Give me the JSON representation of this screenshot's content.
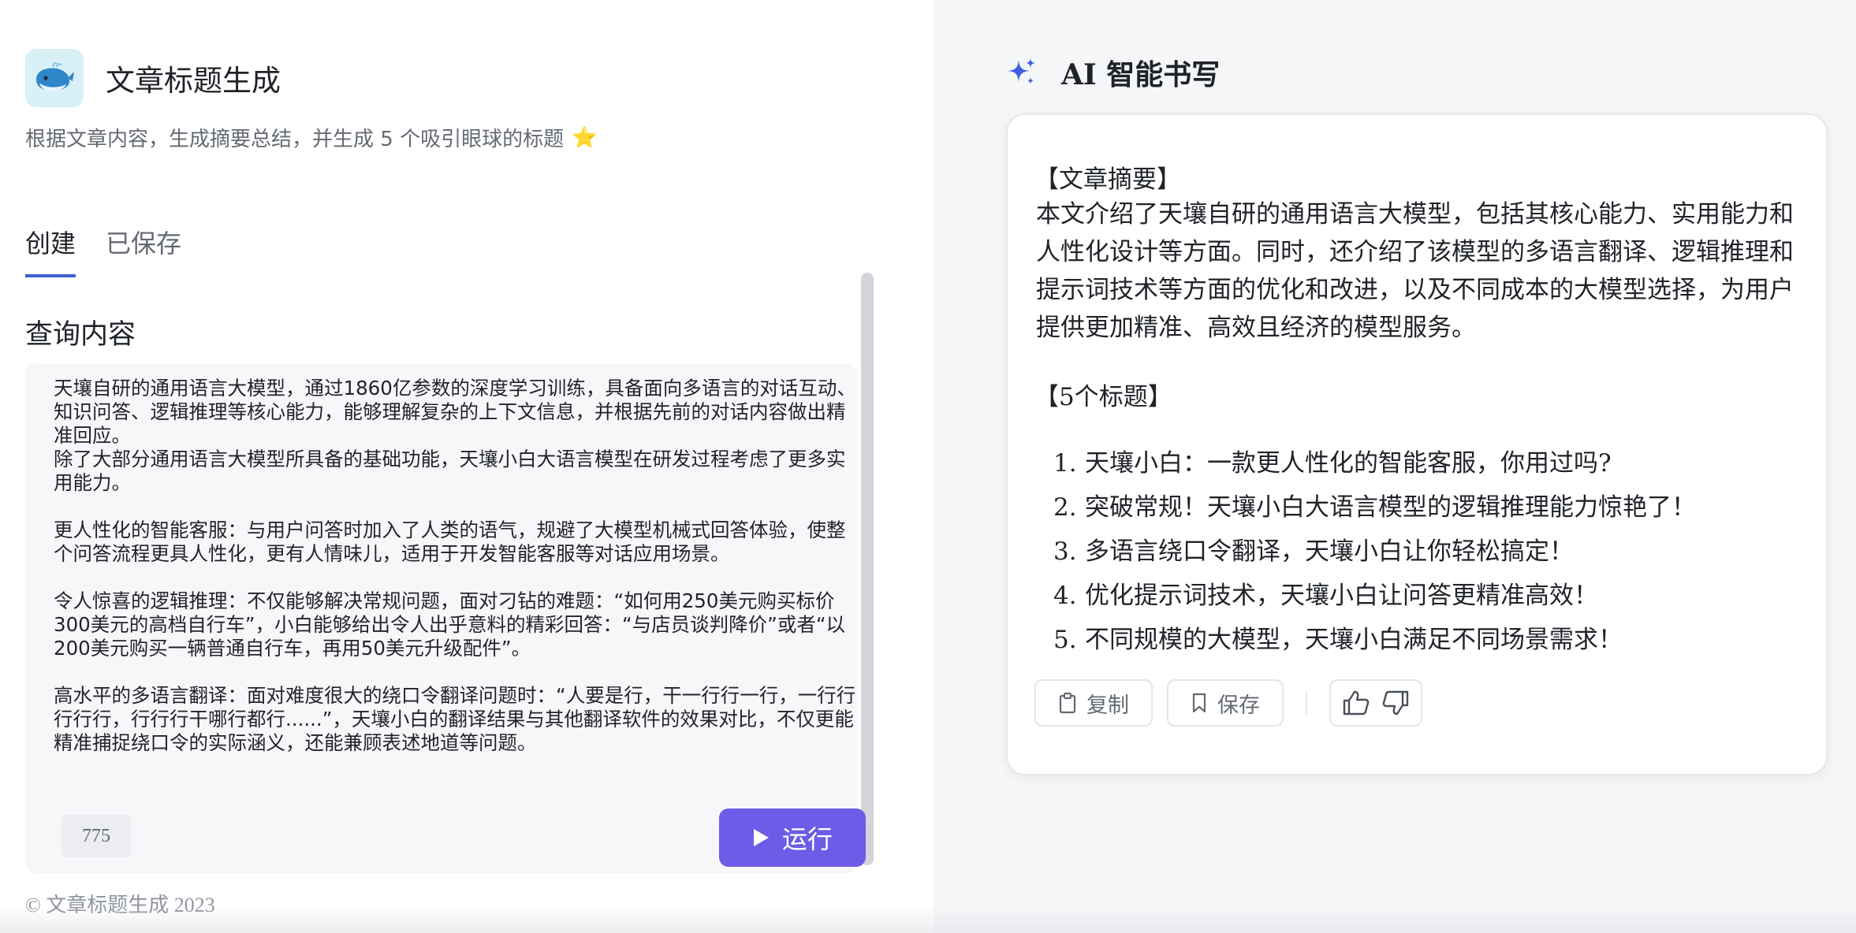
{
  "app": {
    "title": "文章标题生成",
    "description": "根据文章内容，生成摘要总结，并生成 5 个吸引眼球的标题",
    "star": "⭐"
  },
  "tabs": [
    {
      "label": "创建",
      "active": true
    },
    {
      "label": "已保存",
      "active": false
    }
  ],
  "query": {
    "label": "查询内容",
    "text": "天壤自研的通用语言大模型，通过1860亿参数的深度学习训练，具备面向多语言的对话互动、知识问答、逻辑推理等核心能力，能够理解复杂的上下文信息，并根据先前的对话内容做出精准回应。\n除了大部分通用语言大模型所具备的基础功能，天壤小白大语言模型在研发过程考虑了更多实用能力。\n\n更人性化的智能客服：与用户问答时加入了人类的语气，规避了大模型机械式回答体验，使整个问答流程更具人性化，更有人情味儿，适用于开发智能客服等对话应用场景。\n\n令人惊喜的逻辑推理：不仅能够解决常规问题，面对刁钻的难题：“如何用250美元购买标价300美元的高档自行车”，小白能够给出令人出乎意料的精彩回答：“与店员谈判降价”或者“以200美元购买一辆普通自行车，再用50美元升级配件”。\n\n高水平的多语言翻译：面对难度很大的绕口令翻译问题时：“人要是行，干一行行一行，一行行行行行，行行行干哪行都行......”，天壤小白的翻译结果与其他翻译软件的效果对比，不仅更能精准捕捉绕口令的实际涵义，还能兼顾表述地道等问题。",
    "char_count": "775",
    "run_label": "运行"
  },
  "footer": "© 文章标题生成 2023",
  "ai": {
    "title": "AI 智能书写",
    "summary_heading": "【文章摘要】",
    "summary": "本文介绍了天壤自研的通用语言大模型，包括其核心能力、实用能力和人性化设计等方面。同时，还介绍了该模型的多语言翻译、逻辑推理和提示词技术等方面的优化和改进，以及不同成本的大模型选择，为用户提供更加精准、高效且经济的模型服务。",
    "titles_heading": "【5个标题】",
    "titles": [
      {
        "num": "1.",
        "text": "天壤小白：一款更人性化的智能客服，你用过吗?"
      },
      {
        "num": "2.",
        "text": "突破常规！天壤小白大语言模型的逻辑推理能力惊艳了！"
      },
      {
        "num": "3.",
        "text": "多语言绕口令翻译，天壤小白让你轻松搞定！"
      },
      {
        "num": "4.",
        "text": "优化提示词技术，天壤小白让问答更精准高效！"
      },
      {
        "num": "5.",
        "text": "不同规模的大模型，天壤小白满足不同场景需求！"
      }
    ],
    "copy_label": "复制",
    "save_label": "保存"
  },
  "colors": {
    "accent": "#6c5ce7",
    "tab_underline": "#3c5fd6",
    "sparkle": "#3f5fe0"
  },
  "icons": [
    "whale-icon",
    "star-icon",
    "sparkle-icon",
    "play-icon",
    "clipboard-icon",
    "bookmark-icon",
    "thumbs-up-icon",
    "thumbs-down-icon"
  ]
}
